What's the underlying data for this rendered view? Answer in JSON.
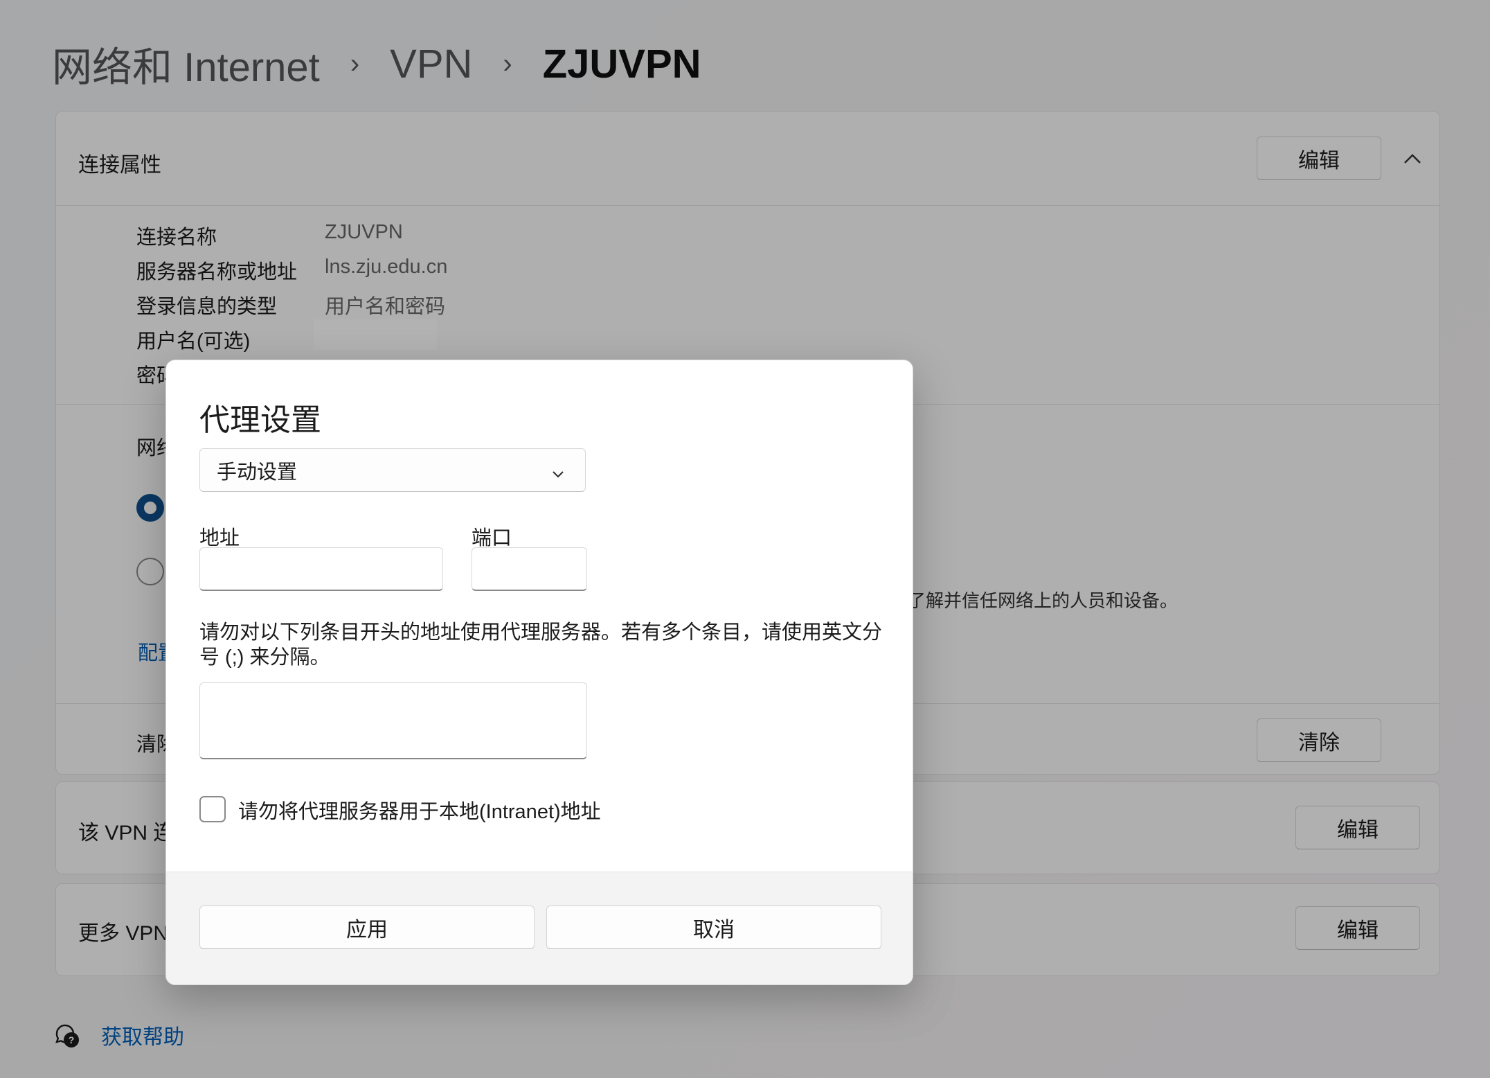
{
  "breadcrumb": {
    "level1": "网络和 Internet",
    "level2": "VPN",
    "current": "ZJUVPN",
    "separator": "›"
  },
  "connection_props": {
    "title": "连接属性",
    "edit_label": "编辑",
    "rows": [
      {
        "label": "连接名称",
        "value": "ZJUVPN"
      },
      {
        "label": "服务器名称或地址",
        "value": "lns.zju.edu.cn"
      },
      {
        "label": "登录信息的类型",
        "value": "用户名和密码"
      },
      {
        "label": "用户名(可选)",
        "value": ""
      },
      {
        "label": "密码",
        "value": ""
      }
    ],
    "network_label_partial": "网络",
    "trust_text_partial": "了解并信任网络上的人员和设备。",
    "config_link_partial": "配置",
    "clear_label_partial": "清除",
    "clear_button": "清除"
  },
  "cards": {
    "vpn_connect_partial": "该 VPN 连",
    "vpn_connect_edit": "编辑",
    "more_vpn_partial": "更多 VPN",
    "more_vpn_edit": "编辑"
  },
  "dialog": {
    "title": "代理设置",
    "mode_selected": "手动设置",
    "address_label": "地址",
    "address_value": "",
    "port_label": "端口",
    "port_value": "",
    "exceptions_note": "请勿对以下列条目开头的地址使用代理服务器。若有多个条目，请使用英文分号 (;) 来分隔。",
    "exceptions_value": "",
    "bypass_local_label": "请勿将代理服务器用于本地(Intranet)地址",
    "bypass_local_checked": false,
    "apply_label": "应用",
    "cancel_label": "取消"
  },
  "help": {
    "label": "获取帮助"
  },
  "colors": {
    "accent": "#005fb8",
    "radio_selected": "#0f4f8f"
  },
  "icons": {
    "chevron_up": "chevron-up-icon",
    "chevron_down": "chevron-down-icon",
    "help": "help-chat-icon"
  }
}
